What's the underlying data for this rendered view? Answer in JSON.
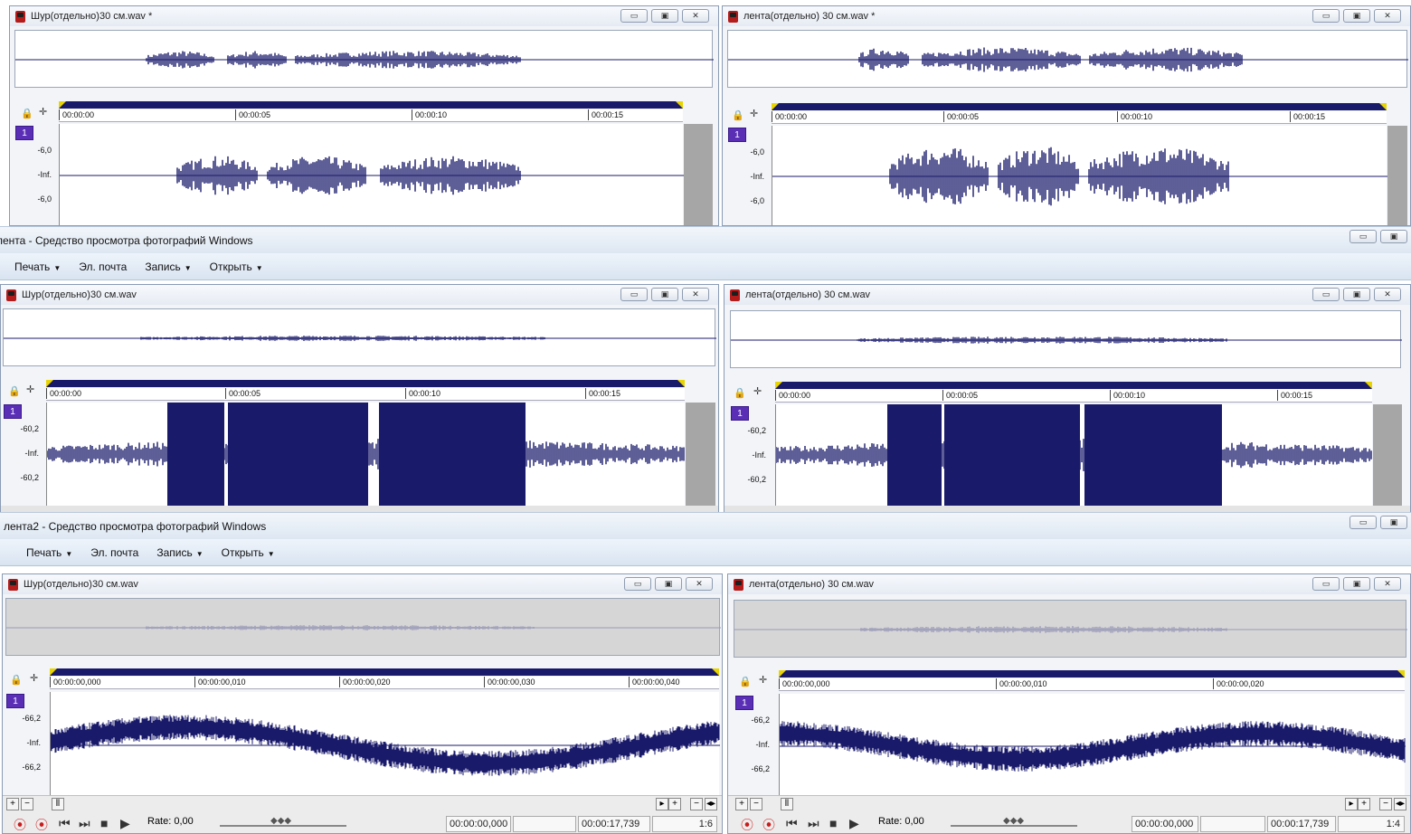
{
  "band1": {
    "left": {
      "title": "Шур(отдельно)30 см.wav *",
      "ticks": [
        "00:00:00",
        "00:00:05",
        "00:00:10",
        "00:00:15"
      ],
      "db": [
        "-6,0",
        "-Inf.",
        "-6,0"
      ],
      "channel": "1"
    },
    "right": {
      "title": "лента(отдельно) 30 см.wav *",
      "ticks": [
        "00:00:00",
        "00:00:05",
        "00:00:10",
        "00:00:15"
      ],
      "db": [
        "-6,0",
        "-Inf.",
        "-6,0"
      ],
      "channel": "1"
    }
  },
  "viewer1": {
    "title": "лента - Средство просмотра фотографий Windows",
    "menu": [
      "Печать",
      "Эл. почта",
      "Запись",
      "Открыть"
    ]
  },
  "band2": {
    "left": {
      "title": "Шур(отдельно)30 см.wav",
      "ticks": [
        "00:00:00",
        "00:00:05",
        "00:00:10",
        "00:00:15"
      ],
      "db": [
        "-60,2",
        "-Inf.",
        "-60,2"
      ],
      "channel": "1"
    },
    "right": {
      "title": "лента(отдельно) 30 см.wav",
      "ticks": [
        "00:00:00",
        "00:00:05",
        "00:00:10",
        "00:00:15"
      ],
      "db": [
        "-60,2",
        "-Inf.",
        "-60,2"
      ],
      "channel": "1"
    }
  },
  "viewer2": {
    "title": "лента2 - Средство просмотра фотографий Windows",
    "menu": [
      "Печать",
      "Эл. почта",
      "Запись",
      "Открыть"
    ]
  },
  "band3": {
    "left": {
      "title": "Шур(отдельно)30 см.wav",
      "ticks": [
        "00:00:00,000",
        "00:00:00,010",
        "00:00:00,020",
        "00:00:00,030",
        "00:00:00,040"
      ],
      "db": [
        "-66,2",
        "-Inf.",
        "-66,2"
      ],
      "channel": "1",
      "rate": "Rate: 0,00",
      "time_start": "00:00:00,000",
      "time_end": "00:00:17,739",
      "zoom": "1:6"
    },
    "right": {
      "title": "лента(отдельно) 30 см.wav",
      "ticks": [
        "00:00:00,000",
        "00:00:00,010",
        "00:00:00,020"
      ],
      "db": [
        "-66,2",
        "-Inf.",
        "-66,2"
      ],
      "channel": "1",
      "rate": "Rate: 0,00",
      "time_start": "00:00:00,000",
      "time_end": "00:00:17,739",
      "zoom": "1:4"
    }
  },
  "colors": {
    "wave": "#1a1a6b",
    "wave_faded": "#9a9ab8",
    "badge": "#5a2fb6",
    "ruler_bar": "#1a1a6b"
  },
  "icons": {
    "lock": "lock-icon",
    "snap": "snap-icon",
    "min": "minimize-icon",
    "max": "maximize-icon",
    "close": "close-icon"
  }
}
